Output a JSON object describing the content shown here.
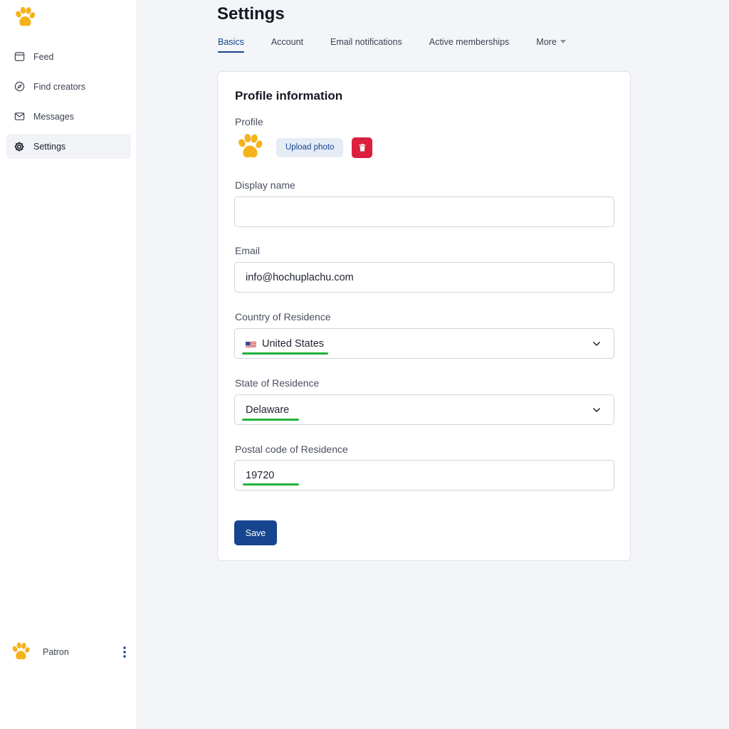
{
  "colors": {
    "accent": "#17458f",
    "danger": "#dc1f3e",
    "highlight": "#22b33a",
    "paw": "#f5b21a"
  },
  "sidebar": {
    "logo_icon": "paw-icon",
    "items": [
      {
        "label": "Feed",
        "icon": "feed-icon"
      },
      {
        "label": "Find creators",
        "icon": "compass-icon"
      },
      {
        "label": "Messages",
        "icon": "mail-icon"
      },
      {
        "label": "Settings",
        "icon": "gear-icon",
        "active": true
      }
    ],
    "footer": {
      "name": "Patron",
      "avatar_icon": "paw-icon",
      "menu_icon": "kebab-icon"
    }
  },
  "header": {
    "title": "Settings"
  },
  "tabs": [
    {
      "label": "Basics",
      "active": true
    },
    {
      "label": "Account"
    },
    {
      "label": "Email notifications"
    },
    {
      "label": "Active memberships"
    },
    {
      "label": "More",
      "icon": "caret-down-icon"
    }
  ],
  "card": {
    "title": "Profile information",
    "profile": {
      "label": "Profile",
      "upload_label": "Upload photo",
      "delete_icon": "trash-icon"
    },
    "display_name": {
      "label": "Display name",
      "value": ""
    },
    "email": {
      "label": "Email",
      "value": "info@hochuplachu.com"
    },
    "country": {
      "label": "Country of Residence",
      "value": "United States",
      "flag_icon": "us-flag-icon"
    },
    "state": {
      "label": "State of Residence",
      "value": "Delaware"
    },
    "postal": {
      "label": "Postal code of Residence",
      "value": "19720"
    },
    "save_label": "Save"
  }
}
